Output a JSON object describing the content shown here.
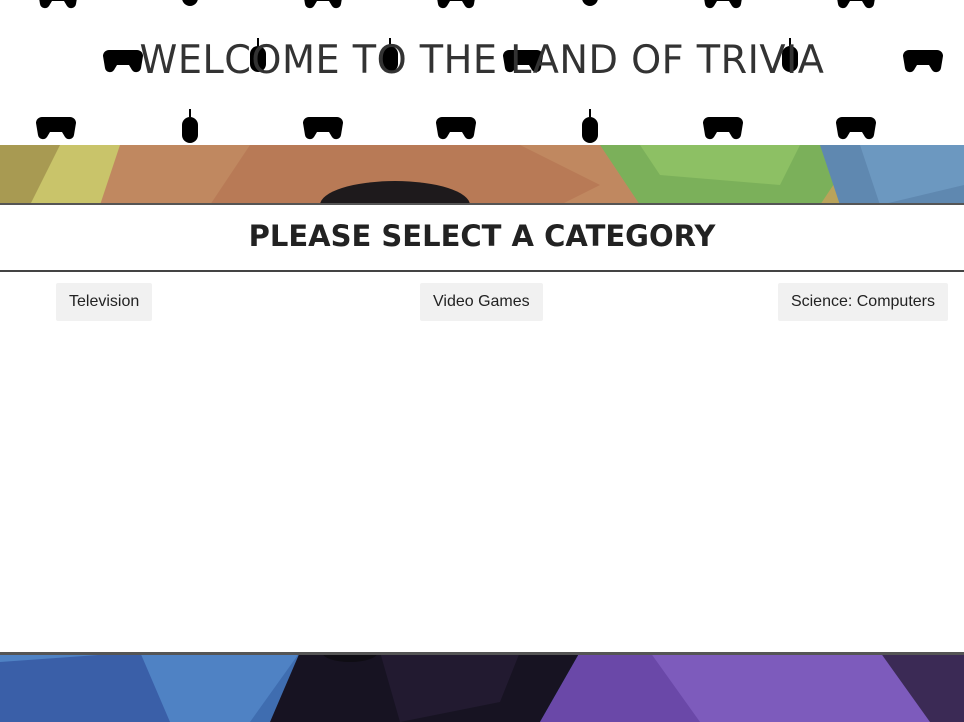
{
  "header": {
    "title": "WELCOME TO THE LAND OF TRIVIA",
    "pattern_icons": [
      "gamepad-icon",
      "mouse-icon"
    ],
    "pattern_color": "#d9d9d9"
  },
  "main": {
    "heading": "PLEASE SELECT A CATEGORY",
    "categories": [
      {
        "label": "Television"
      },
      {
        "label": "Video Games"
      },
      {
        "label": "Science: Computers"
      }
    ]
  },
  "colors": {
    "title_text": "#333333",
    "button_bg": "#f1f1f1",
    "rule": "#444444"
  }
}
